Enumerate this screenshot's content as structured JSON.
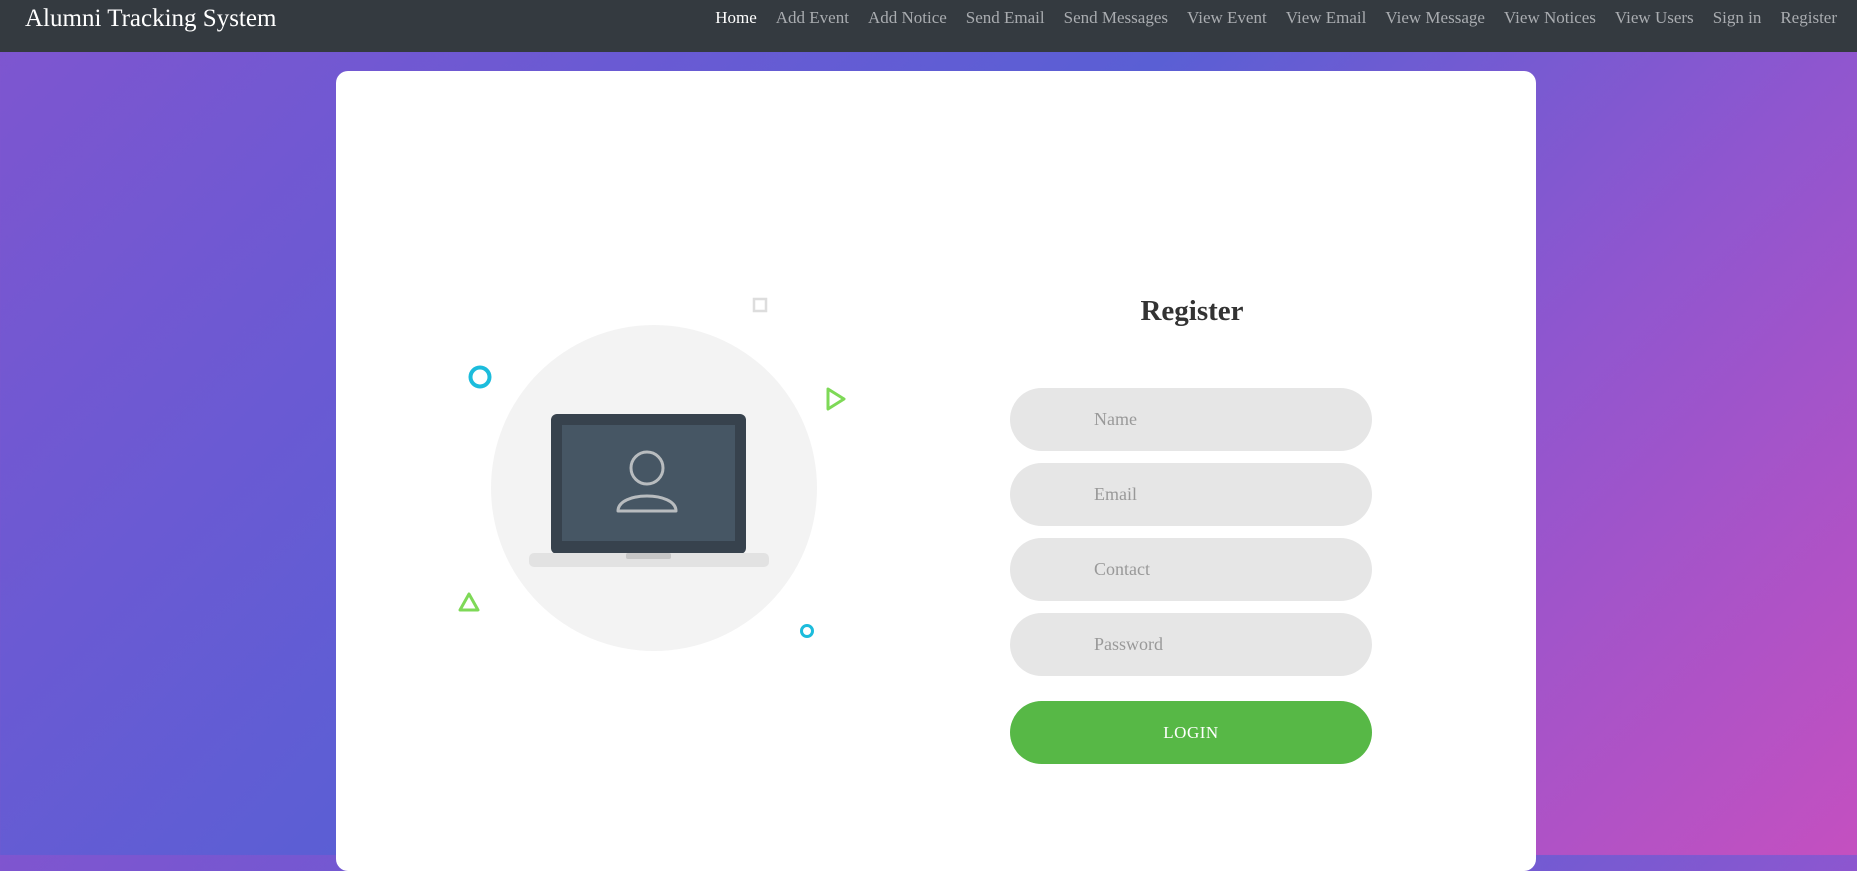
{
  "app": {
    "title": "Alumni Tracking System"
  },
  "nav": {
    "items": [
      {
        "label": "Home",
        "active": true
      },
      {
        "label": "Add Event"
      },
      {
        "label": "Add Notice"
      },
      {
        "label": "Send Email"
      },
      {
        "label": "Send Messages"
      },
      {
        "label": "View Event"
      },
      {
        "label": "View Email"
      },
      {
        "label": "View Message"
      },
      {
        "label": "View Notices"
      },
      {
        "label": "View Users"
      },
      {
        "label": "Sign in"
      },
      {
        "label": "Register"
      }
    ]
  },
  "form": {
    "title": "Register",
    "name_placeholder": "Name",
    "email_placeholder": "Email",
    "contact_placeholder": "Contact",
    "password_placeholder": "Password",
    "submit_label": "LOGIN"
  },
  "illustration": {
    "icon": "laptop-user-icon"
  },
  "colors": {
    "navbar": "#343a40",
    "accent_green": "#57b846",
    "input_bg": "#e6e6e6",
    "deco_cyan": "#1cbcdc",
    "deco_green": "#7ed957"
  }
}
